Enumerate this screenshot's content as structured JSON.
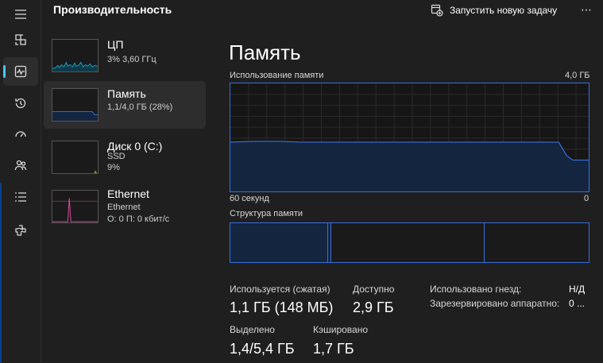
{
  "header": {
    "title": "Производительность",
    "new_task_label": "Запустить новую задачу",
    "more_label": "⋯"
  },
  "rail": {
    "items": [
      {
        "icon": "hamburger-menu-icon"
      },
      {
        "icon": "processes-icon"
      },
      {
        "icon": "performance-icon",
        "active": true
      },
      {
        "icon": "app-history-icon"
      },
      {
        "icon": "startup-apps-icon"
      },
      {
        "icon": "users-icon"
      },
      {
        "icon": "details-icon"
      },
      {
        "icon": "services-icon"
      }
    ]
  },
  "devices": [
    {
      "name": "ЦП",
      "sub1": "3% 3,60 ГГц",
      "sub2": ""
    },
    {
      "name": "Память",
      "sub1": "1,1/4,0 ГБ (28%)",
      "sub2": ""
    },
    {
      "name": "Диск 0 (C:)",
      "sub1": "SSD",
      "sub2": "9%"
    },
    {
      "name": "Ethernet",
      "sub1": "Ethernet",
      "sub2": "О: 0 П: 0 кбит/с"
    }
  ],
  "panel": {
    "title": "Память",
    "usage_label": "Использование памяти",
    "usage_max": "4,0 ГБ",
    "time_left": "60 секунд",
    "time_right": "0",
    "structure_label": "Структура памяти"
  },
  "stats": {
    "in_use_label": "Используется (сжатая)",
    "in_use_value": "1,1 ГБ (148 МБ)",
    "available_label": "Доступно",
    "available_value": "2,9 ГБ",
    "committed_label": "Выделено",
    "committed_value": "1,4/5,4 ГБ",
    "cached_label": "Кэшировано",
    "cached_value": "1,7 ГБ",
    "slots_label": "Использовано гнезд:",
    "slots_value": "Н/Д",
    "reserved_label": "Зарезервировано аппаратно:",
    "reserved_value": "0 ..."
  },
  "colors": {
    "accent": "#4cc2ff",
    "graph_line": "#3a6fd8",
    "graph_fill": "#142540",
    "cpu_line": "#17a2c8",
    "ethernet_line": "#d94ea0"
  }
}
